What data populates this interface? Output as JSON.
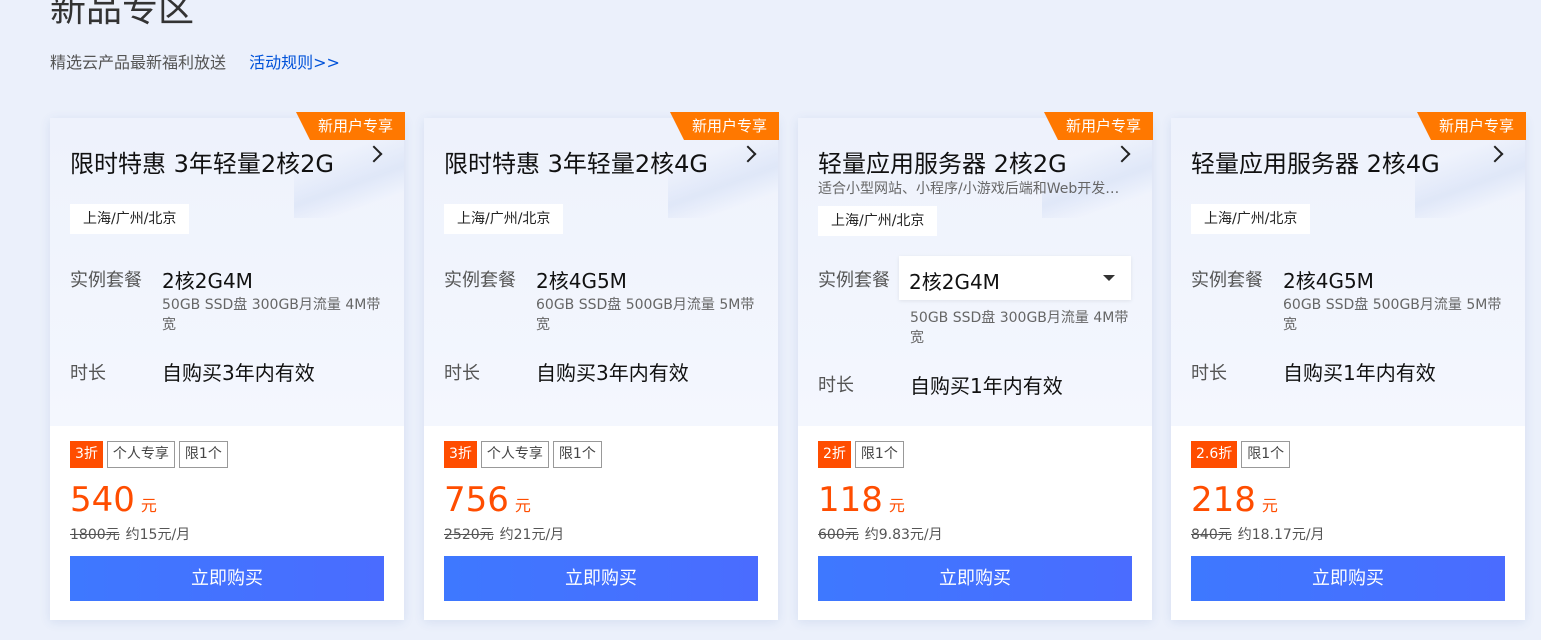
{
  "section": {
    "title": "新品专区",
    "desc": "精选云产品最新福利放送",
    "rules_link": "活动规则>>"
  },
  "colors": {
    "accent": "#ff4d00",
    "badge": "#ff7800",
    "button": "#3e78ff",
    "link": "#0052d9"
  },
  "cards": [
    {
      "badge": "新用户专享",
      "title": "限时特惠 3年轻量2核2G",
      "region": "上海/广州/北京",
      "spec_label": "实例套餐",
      "spec_value": "2核2G4M",
      "spec_note": "50GB SSD盘 300GB月流量 4M带宽",
      "duration_label": "时长",
      "duration_value": "自购买3年内有效",
      "discount": "3折",
      "tags": [
        "个人专享",
        "限1个"
      ],
      "price": "540",
      "price_unit": "元",
      "original_price": "1800元",
      "monthly": "约15元/月",
      "buy_label": "立即购买"
    },
    {
      "badge": "新用户专享",
      "title": "限时特惠 3年轻量2核4G",
      "region": "上海/广州/北京",
      "spec_label": "实例套餐",
      "spec_value": "2核4G5M",
      "spec_note": "60GB SSD盘 500GB月流量 5M带宽",
      "duration_label": "时长",
      "duration_value": "自购买3年内有效",
      "discount": "3折",
      "tags": [
        "个人专享",
        "限1个"
      ],
      "price": "756",
      "price_unit": "元",
      "original_price": "2520元",
      "monthly": "约21元/月",
      "buy_label": "立即购买"
    },
    {
      "badge": "新用户专享",
      "title": "轻量应用服务器 2核2G",
      "desc": "适合小型网站、小程序/小游戏后端和Web开发测试",
      "region": "上海/广州/北京",
      "spec_label": "实例套餐",
      "spec_value": "2核2G4M",
      "spec_note": "50GB SSD盘 300GB月流量 4M带宽",
      "duration_label": "时长",
      "duration_value": "自购买1年内有效",
      "discount": "2折",
      "tags": [
        "限1个"
      ],
      "price": "118",
      "price_unit": "元",
      "original_price": "600元",
      "monthly": "约9.83元/月",
      "buy_label": "立即购买"
    },
    {
      "badge": "新用户专享",
      "title": "轻量应用服务器 2核4G",
      "region": "上海/广州/北京",
      "spec_label": "实例套餐",
      "spec_value": "2核4G5M",
      "spec_note": "60GB SSD盘 500GB月流量 5M带宽",
      "duration_label": "时长",
      "duration_value": "自购买1年内有效",
      "discount": "2.6折",
      "tags": [
        "限1个"
      ],
      "price": "218",
      "price_unit": "元",
      "original_price": "840元",
      "monthly": "约18.17元/月",
      "buy_label": "立即购买"
    }
  ]
}
